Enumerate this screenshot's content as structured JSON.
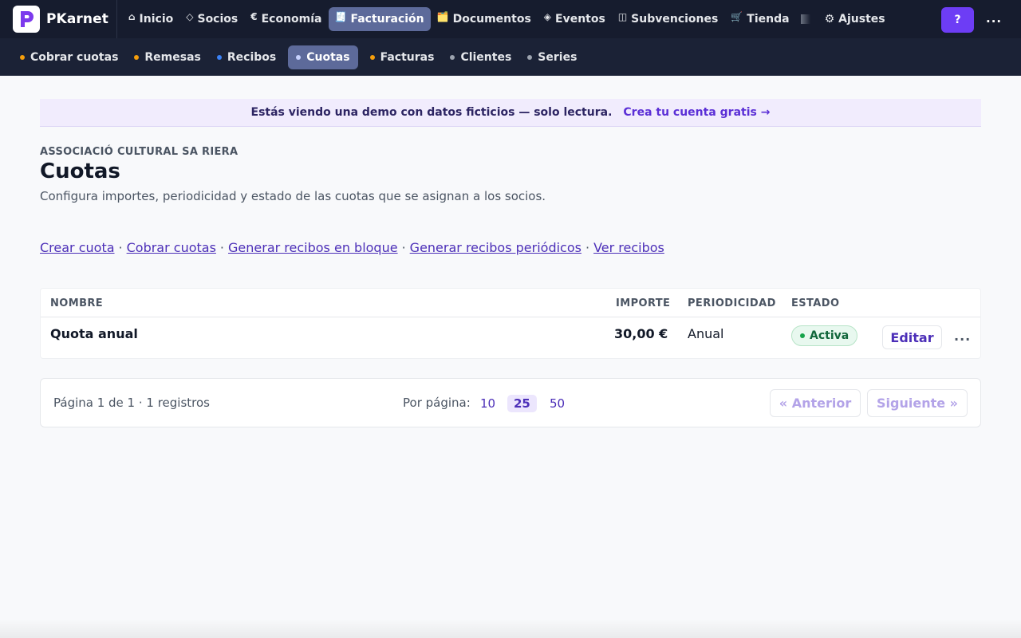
{
  "brand": {
    "name": "PKarnet",
    "logo_letter": "P"
  },
  "nav": {
    "items": [
      {
        "icon": "⌂",
        "label": "Inicio",
        "icon_name": "home-icon"
      },
      {
        "icon": "◇",
        "label": "Socios",
        "icon_name": "diamond-icon"
      },
      {
        "icon": "€",
        "label": "Economía",
        "icon_name": "euro-icon"
      },
      {
        "icon": "🧾",
        "label": "Facturación",
        "icon_name": "receipt-icon",
        "active": true
      },
      {
        "icon": "🗂️",
        "label": "Documentos",
        "icon_name": "folder-icon"
      },
      {
        "icon": "◈",
        "label": "Eventos",
        "icon_name": "events-icon"
      },
      {
        "icon": "◫",
        "label": "Subvenciones",
        "icon_name": "grants-icon"
      },
      {
        "icon": "🛒",
        "label": "Tienda",
        "icon_name": "cart-icon"
      }
    ],
    "settings": {
      "icon": "⚙",
      "label": "Ajustes"
    },
    "help_label": "?",
    "more_label": "..."
  },
  "subnav": {
    "items": [
      {
        "label": "Cobrar cuotas",
        "dot_color": "#f59e0b"
      },
      {
        "label": "Remesas",
        "dot_color": "#f59e0b"
      },
      {
        "label": "Recibos",
        "dot_color": "#3b82f6"
      },
      {
        "label": "Cuotas",
        "dot_color": "#c7d2fe",
        "active": true
      },
      {
        "label": "Facturas",
        "dot_color": "#f59e0b"
      },
      {
        "label": "Clientes",
        "dot_color": "#9ca3af"
      },
      {
        "label": "Series",
        "dot_color": "#9ca3af"
      }
    ]
  },
  "banner": {
    "text": "Estás viendo una demo con datos ficticios — solo lectura.",
    "cta": "Crea tu cuenta gratis →"
  },
  "page": {
    "org": "ASSOCIACIÓ CULTURAL SA RIERA",
    "title": "Cuotas",
    "subtitle": "Configura importes, periodicidad y estado de las cuotas que se asignan a los socios."
  },
  "actions": [
    "Crear cuota",
    "Cobrar cuotas",
    "Generar recibos en bloque",
    "Generar recibos periódicos",
    "Ver recibos"
  ],
  "table": {
    "columns": {
      "name": "NOMBRE",
      "amount": "IMPORTE",
      "period": "PERIODICIDAD",
      "status": "ESTADO"
    },
    "rows": [
      {
        "name": "Quota anual",
        "amount": "30,00 €",
        "period": "Anual",
        "status": "Activa",
        "edit_label": "Editar",
        "more_label": "..."
      }
    ]
  },
  "pagination": {
    "info": "Página 1 de 1 · 1 registros",
    "per_page_label": "Por página:",
    "sizes": [
      "10",
      "25",
      "50"
    ],
    "active_size": "25",
    "prev": "« Anterior",
    "next": "Siguiente »"
  },
  "colors": {
    "accent": "#6d3df5",
    "link": "#4c2fb8",
    "nav_bg": "#161c2e",
    "active_tab": "#5d6a9a",
    "status_active": "#16a34a"
  }
}
